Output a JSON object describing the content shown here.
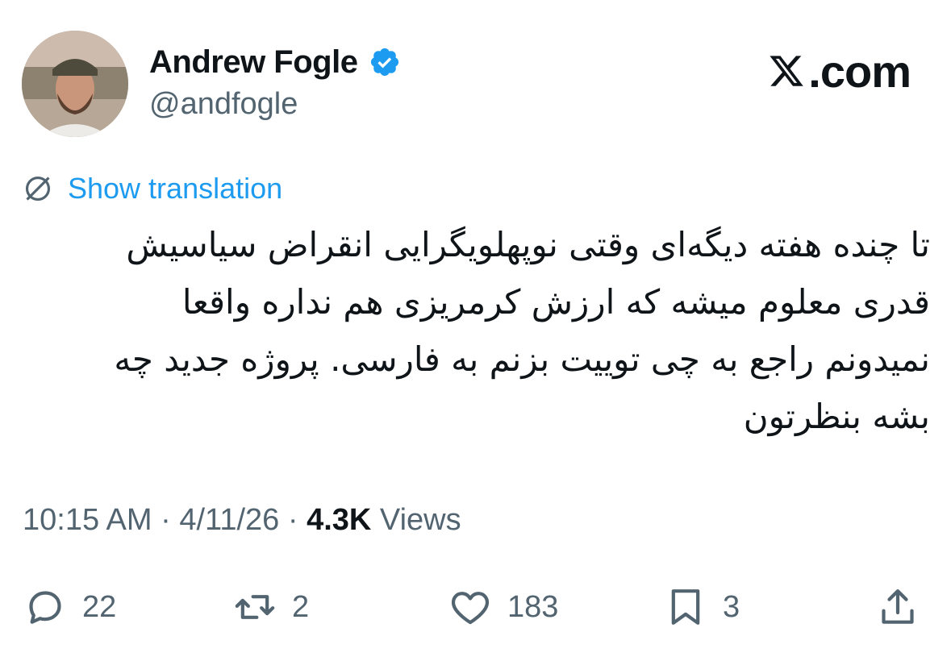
{
  "author": {
    "display_name": "Andrew Fogle",
    "handle": "@andfogle",
    "verified": true,
    "verified_color": "#1d9bf0"
  },
  "brand": {
    "logo_text": ".com",
    "logo_icon": "x-logo-icon"
  },
  "translation": {
    "link_label": "Show translation",
    "icon": "globe-icon",
    "link_color": "#1d9bf0"
  },
  "tweet": {
    "text_lines": [
      "تا چنده هفته دیگه‌ای وقتی نوپهلویگرایی انقراض سیاسیش",
      "قدری معلوم میشه که ارزش کرمریزی هم نداره واقعا",
      "نمیدونم راجع به چی توییت بزنم به فارسی. پروژه جدید چه",
      "بشه بنظرتون"
    ]
  },
  "meta": {
    "time": "10:15 AM",
    "separator_1": " · ",
    "date": "4/11/26",
    "separator_2": " · ",
    "views_count": "4.3K",
    "views_label": " Views"
  },
  "actions": {
    "reply": {
      "icon": "reply-icon",
      "count": "22"
    },
    "repost": {
      "icon": "repost-icon",
      "count": "2"
    },
    "like": {
      "icon": "heart-icon",
      "count": "183"
    },
    "bookmark": {
      "icon": "bookmark-icon",
      "count": "3"
    },
    "share": {
      "icon": "share-icon"
    }
  },
  "colors": {
    "text_primary": "#0f1419",
    "text_secondary": "#536471",
    "accent": "#1d9bf0"
  }
}
